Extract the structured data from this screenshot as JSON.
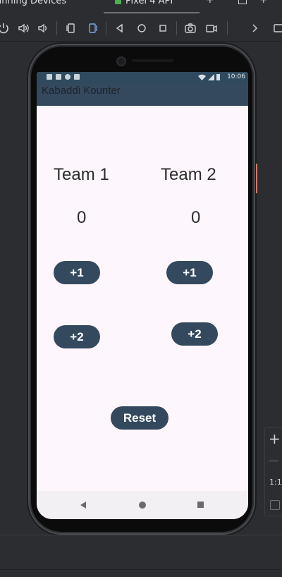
{
  "ide": {
    "tab_left": "unning Devices",
    "tab_device": "Pixel 4 API",
    "colors": {
      "background": "#2b2d30"
    }
  },
  "toolbar": {
    "icons": [
      "power-icon",
      "volume-up-icon",
      "volume-down-icon",
      "rotate-left-icon",
      "rotate-right-icon",
      "back-icon",
      "home-icon",
      "overview-icon",
      "camera-icon",
      "video-icon",
      "chevron-right-icon"
    ]
  },
  "status_bar": {
    "time": "10:06"
  },
  "app": {
    "title": "Kabaddi Kounter",
    "team1": {
      "name": "Team 1",
      "score": "0",
      "plus1": "+1",
      "plus2": "+2"
    },
    "team2": {
      "name": "Team 2",
      "score": "0",
      "plus1": "+1",
      "plus2": "+2"
    },
    "reset_label": "Reset",
    "colors": {
      "appbar": "#35495e",
      "button": "#34495e",
      "screen": "#fdf6fc"
    }
  },
  "zoom": {
    "plus": "+",
    "ratio": "1:1"
  }
}
